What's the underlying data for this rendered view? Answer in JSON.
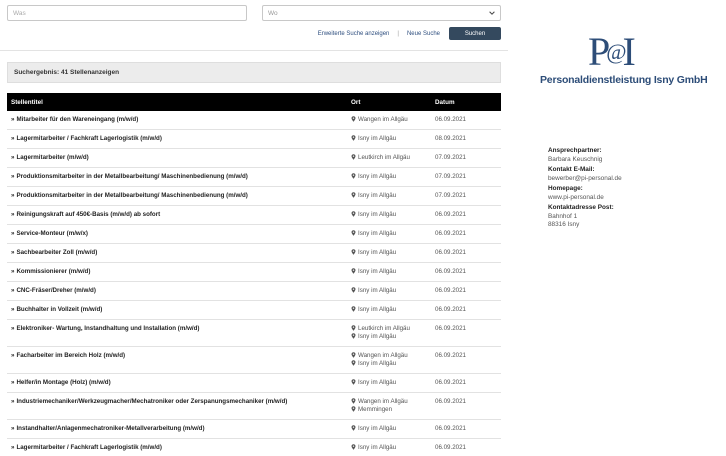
{
  "search": {
    "what_placeholder": "Was",
    "where_value": "Wo",
    "advanced_link": "Erweiterte Suche anzeigen",
    "separator": "|",
    "new_search_link": "Neue Suche",
    "search_button": "Suchen"
  },
  "results": {
    "summary": "Suchergebnis: 41 Stellenanzeigen"
  },
  "table": {
    "headers": [
      "Stellentitel",
      "Ort",
      "Datum"
    ],
    "rows": [
      {
        "title": "Mitarbeiter für den Wareneingang (m/w/d)",
        "locations": [
          "Wangen im Allgäu"
        ],
        "date": "06.09.2021"
      },
      {
        "title": "Lagermitarbeiter / Fachkraft Lagerlogistik (m/w/d)",
        "locations": [
          "Isny im Allgäu"
        ],
        "date": "08.09.2021"
      },
      {
        "title": "Lagermitarbeiter (m/w/d)",
        "locations": [
          "Leutkirch im Allgäu"
        ],
        "date": "07.09.2021"
      },
      {
        "title": "Produktionsmitarbeiter in der Metallbearbeitung/ Maschinenbedienung (m/w/d)",
        "locations": [
          "Isny im Allgäu"
        ],
        "date": "07.09.2021"
      },
      {
        "title": "Produktionsmitarbeiter in der Metallbearbeitung/ Maschinenbedienung (m/w/d)",
        "locations": [
          "Isny im Allgäu"
        ],
        "date": "07.09.2021"
      },
      {
        "title": "Reinigungskraft auf 450€-Basis (m/w/d) ab sofort",
        "locations": [
          "Isny im Allgäu"
        ],
        "date": "06.09.2021"
      },
      {
        "title": "Service-Monteur (m/w/x)",
        "locations": [
          "Isny im Allgäu"
        ],
        "date": "06.09.2021"
      },
      {
        "title": "Sachbearbeiter Zoll (m/w/d)",
        "locations": [
          "Isny im Allgäu"
        ],
        "date": "06.09.2021"
      },
      {
        "title": "Kommissionierer (m/w/d)",
        "locations": [
          "Isny im Allgäu"
        ],
        "date": "06.09.2021"
      },
      {
        "title": "CNC-Fräser/Dreher (m/w/d)",
        "locations": [
          "Isny im Allgäu"
        ],
        "date": "06.09.2021"
      },
      {
        "title": "Buchhalter in Vollzeit (m/w/d)",
        "locations": [
          "Isny im Allgäu"
        ],
        "date": "06.09.2021"
      },
      {
        "title": "Elektroniker- Wartung, Instandhaltung und Installation (m/w/d)",
        "locations": [
          "Leutkirch im Allgäu",
          "Isny im Allgäu"
        ],
        "date": "06.09.2021"
      },
      {
        "title": "Facharbeiter im Bereich Holz (m/w/d)",
        "locations": [
          "Wangen im Allgäu",
          "Isny im Allgäu"
        ],
        "date": "06.09.2021"
      },
      {
        "title": "Helfer/in Montage (Holz) (m/w/d)",
        "locations": [
          "Isny im Allgäu"
        ],
        "date": "06.09.2021"
      },
      {
        "title": "Industriemechaniker/Werkzeugmacher/Mechatroniker oder Zerspanungsmechaniker (m/w/d)",
        "locations": [
          "Wangen im Allgäu",
          "Memmingen"
        ],
        "date": "06.09.2021"
      },
      {
        "title": "Instandhalter/Anlagenmechatroniker-Metallverarbeitung (m/w/d)",
        "locations": [
          "Isny im Allgäu"
        ],
        "date": "06.09.2021"
      },
      {
        "title": "Lagermitarbeiter / Fachkraft Lagerlogistik (m/w/d)",
        "locations": [
          "Isny im Allgäu"
        ],
        "date": "06.09.2021"
      }
    ]
  },
  "logo": {
    "mark_p": "P",
    "mark_at": "@",
    "mark_i": "I",
    "text": "Personaldienstleistung Isny GmbH",
    "color": "#2d4d78"
  },
  "contact": {
    "person_label": "Ansprechpartner:",
    "person": "Barbara Keuschnig",
    "email_label": "Kontakt E-Mail:",
    "email": "bewerber@pi-personal.de",
    "homepage_label": "Homepage:",
    "homepage": "www.pi-personal.de",
    "address_label": "Kontaktadresse Post:",
    "street": "Bahnhof 1",
    "city": "88316 Isny"
  }
}
